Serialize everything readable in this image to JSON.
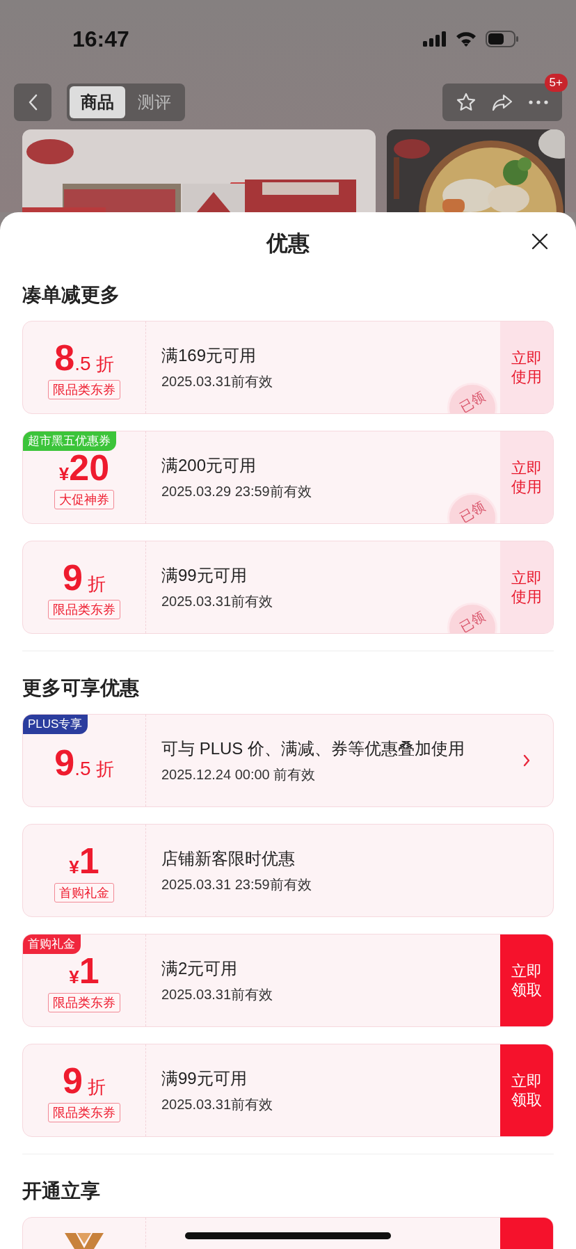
{
  "status_bar": {
    "time": "16:47"
  },
  "nav": {
    "tabs": [
      {
        "label": "商品",
        "selected": true
      },
      {
        "label": "测评",
        "selected": false
      }
    ],
    "badge": "5+"
  },
  "sheet": {
    "title": "优惠",
    "sections": [
      {
        "title": "凑单减更多",
        "coupons": [
          {
            "number": "8",
            "decimal": ".5",
            "suffix": "折",
            "tag": "限品类东券",
            "condition": "满169元可用",
            "validity": "2025.03.31前有效",
            "action": {
              "kind": "use",
              "label": "立即使用"
            },
            "stamp": "已领"
          },
          {
            "corner_tag": {
              "text": "超市黑五优惠券",
              "color": "#3cc43a"
            },
            "prefix": "¥",
            "number": "20",
            "tag": "大促神券",
            "condition": "满200元可用",
            "validity": "2025.03.29 23:59前有效",
            "action": {
              "kind": "use",
              "label": "立即使用"
            },
            "stamp": "已领"
          },
          {
            "number": "9",
            "suffix": "折",
            "tag": "限品类东券",
            "condition": "满99元可用",
            "validity": "2025.03.31前有效",
            "action": {
              "kind": "use",
              "label": "立即使用"
            },
            "stamp": "已领"
          }
        ]
      },
      {
        "title": "更多可享优惠",
        "coupons": [
          {
            "corner_tag": {
              "text": "PLUS专享",
              "color": "#2b3d9e"
            },
            "number": "9",
            "decimal": ".5",
            "suffix": "折",
            "condition": "可与 PLUS 价、满减、券等优惠叠加使用",
            "validity": "2025.12.24 00:00 前有效",
            "action": {
              "kind": "arrow"
            }
          },
          {
            "prefix": "¥",
            "number": "1",
            "tag": "首购礼金",
            "condition": "店铺新客限时优惠",
            "validity": "2025.03.31 23:59前有效",
            "action": {
              "kind": "none"
            }
          },
          {
            "corner_tag": {
              "text": "首购礼金",
              "color": "#f0263c"
            },
            "prefix": "¥",
            "number": "1",
            "tag": "限品类东券",
            "condition": "满2元可用",
            "validity": "2025.03.31前有效",
            "action": {
              "kind": "claim",
              "label": "立即领取"
            }
          },
          {
            "number": "9",
            "suffix": "折",
            "tag": "限品类东券",
            "condition": "满99元可用",
            "validity": "2025.03.31前有效",
            "action": {
              "kind": "claim",
              "label": "立即领取"
            }
          }
        ]
      },
      {
        "title": "开通立享",
        "coupons": [
          {
            "kind": "logo",
            "action": {
              "kind": "claim"
            }
          }
        ]
      }
    ]
  }
}
